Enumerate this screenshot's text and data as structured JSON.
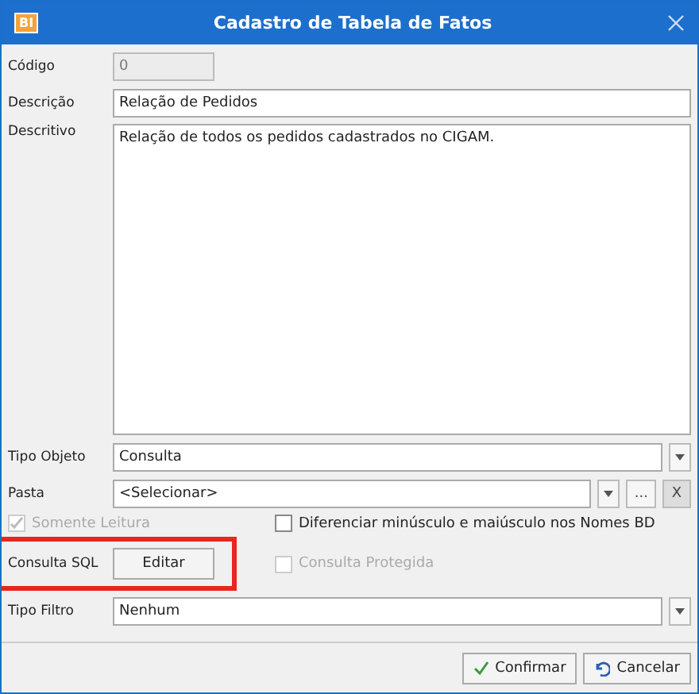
{
  "window": {
    "title": "Cadastro de Tabela de Fatos",
    "app_badge": "BI"
  },
  "fields": {
    "codigo": {
      "label": "Código",
      "value": "0",
      "disabled": true
    },
    "descricao": {
      "label": "Descrição",
      "value": "Relação de Pedidos"
    },
    "descritivo": {
      "label": "Descritivo",
      "value": "Relação de todos os pedidos cadastrados no CIGAM."
    },
    "tipo_objeto": {
      "label": "Tipo Objeto",
      "value": "Consulta"
    },
    "pasta": {
      "label": "Pasta",
      "value": "<Selecionar>",
      "browse": "...",
      "clear": "X"
    }
  },
  "checkboxes": [
    {
      "label": "Somente Leitura",
      "checked": true,
      "disabled": true
    },
    {
      "label": "Diferenciar minúsculo e maiúsculo nos Nomes BD",
      "checked": false,
      "disabled": false
    },
    {
      "label": "Consulta Protegida",
      "checked": false,
      "disabled": true
    }
  ],
  "consulta_sql": {
    "label": "Consulta SQL",
    "button": "Editar",
    "highlighted": true
  },
  "tipo_filtro": {
    "label": "Tipo Filtro",
    "value": "Nenhum"
  },
  "buttons": [
    {
      "label": "Confirmar",
      "kind": "confirm"
    },
    {
      "label": "Cancelar",
      "kind": "cancel"
    }
  ]
}
